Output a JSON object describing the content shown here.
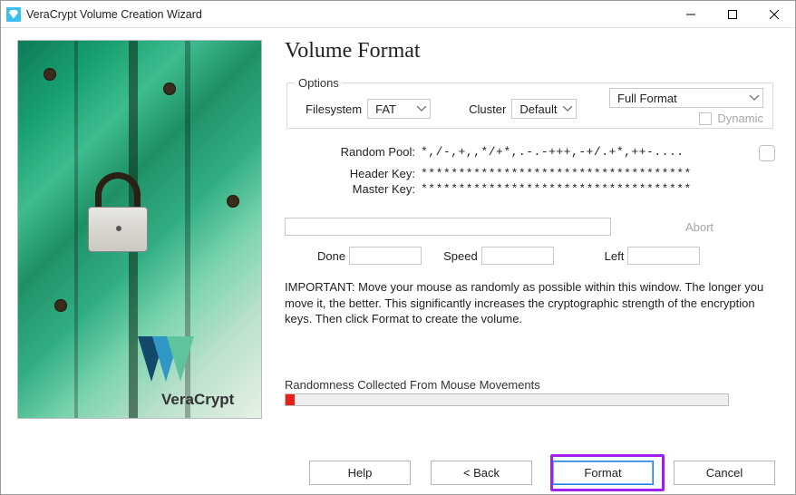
{
  "window": {
    "title": "VeraCrypt Volume Creation Wizard"
  },
  "page": {
    "heading": "Volume Format",
    "options_legend": "Options",
    "filesystem_label": "Filesystem",
    "filesystem_value": "FAT",
    "cluster_label": "Cluster",
    "cluster_value": "Default",
    "format_mode": "Full Format",
    "dynamic_label": "Dynamic"
  },
  "keys": {
    "random_pool_label": "Random Pool:",
    "random_pool_value": "*,/-,+,,*/+*,.-.-+++,-+/.+*,++-....",
    "header_key_label": "Header Key:",
    "header_key_value": "************************************",
    "master_key_label": "Master Key:",
    "master_key_value": "************************************"
  },
  "progress": {
    "abort_label": "Abort",
    "done_label": "Done",
    "done_value": "",
    "speed_label": "Speed",
    "speed_value": "",
    "left_label": "Left",
    "left_value": ""
  },
  "important_text": "IMPORTANT: Move your mouse as randomly as possible within this window. The longer you move it, the better. This significantly increases the cryptographic strength of the encryption keys. Then click Format to create the volume.",
  "randomness": {
    "label": "Randomness Collected From Mouse Movements",
    "percent": 2
  },
  "buttons": {
    "help": "Help",
    "back": "<  Back",
    "format": "Format",
    "cancel": "Cancel"
  },
  "sidebar": {
    "brand": "VeraCrypt"
  }
}
